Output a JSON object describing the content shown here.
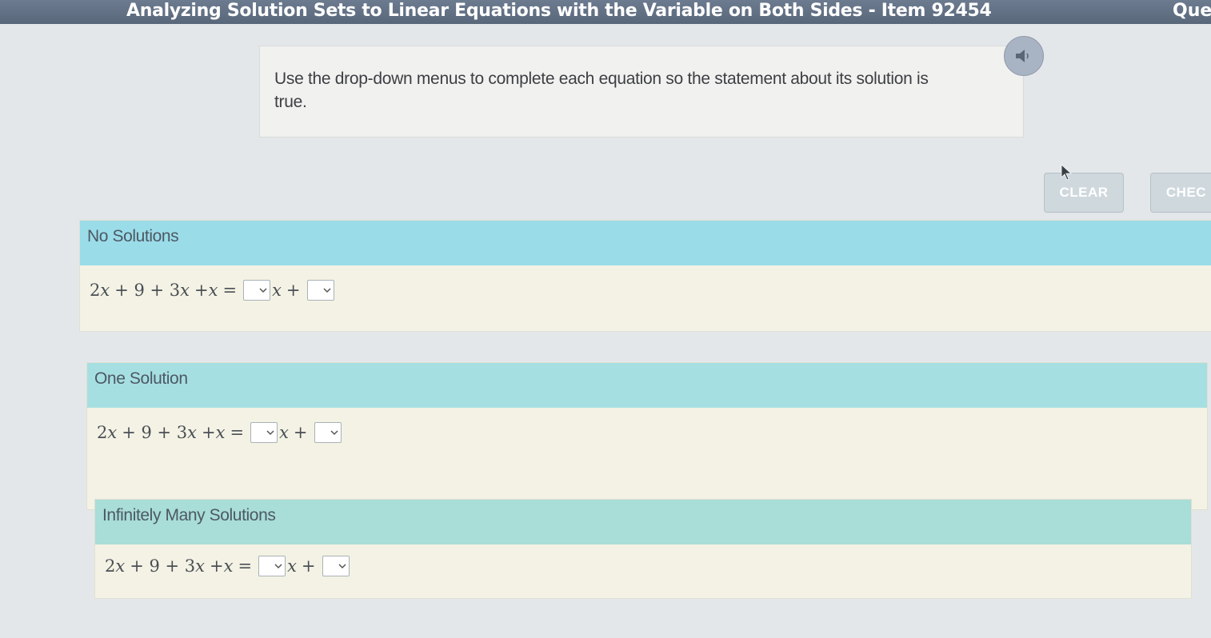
{
  "header": {
    "title": "Analyzing Solution Sets to Linear Equations with the Variable on Both Sides - Item 92454",
    "right_text": "Que"
  },
  "instructions": {
    "text": "Use the drop-down menus to complete each equation so the statement about its solution is true."
  },
  "speaker": {
    "icon": "speaker-icon"
  },
  "buttons": {
    "clear_label": "CLEAR",
    "check_label": "CHEC"
  },
  "groups": [
    {
      "label": "No Solutions",
      "equation": {
        "lhs_1": "2",
        "lhs_2": "x",
        "lhs_3": " + 9 + 3",
        "lhs_4": "x",
        "lhs_5": " + ",
        "lhs_6": "x",
        "equals": " = ",
        "var": "x",
        "plus": " + "
      }
    },
    {
      "label": "One Solution",
      "equation": {
        "lhs_1": "2",
        "lhs_2": "x",
        "lhs_3": " + 9 + 3",
        "lhs_4": "x",
        "lhs_5": " + ",
        "lhs_6": "x",
        "equals": " = ",
        "var": "x",
        "plus": " + "
      }
    },
    {
      "label": "Infinitely Many Solutions",
      "equation": {
        "lhs_1": "2",
        "lhs_2": "x",
        "lhs_3": " + 9 + 3",
        "lhs_4": "x",
        "lhs_5": " + ",
        "lhs_6": "x",
        "equals": " = ",
        "var": "x",
        "plus": " + "
      }
    }
  ],
  "colors": {
    "topbar": "#5f6e82",
    "header_no_solutions": "#9bdce9",
    "header_one_solution": "#a6dfe2",
    "header_infinite": "#a9ddd7",
    "panel_background": "#f3f2e4"
  }
}
